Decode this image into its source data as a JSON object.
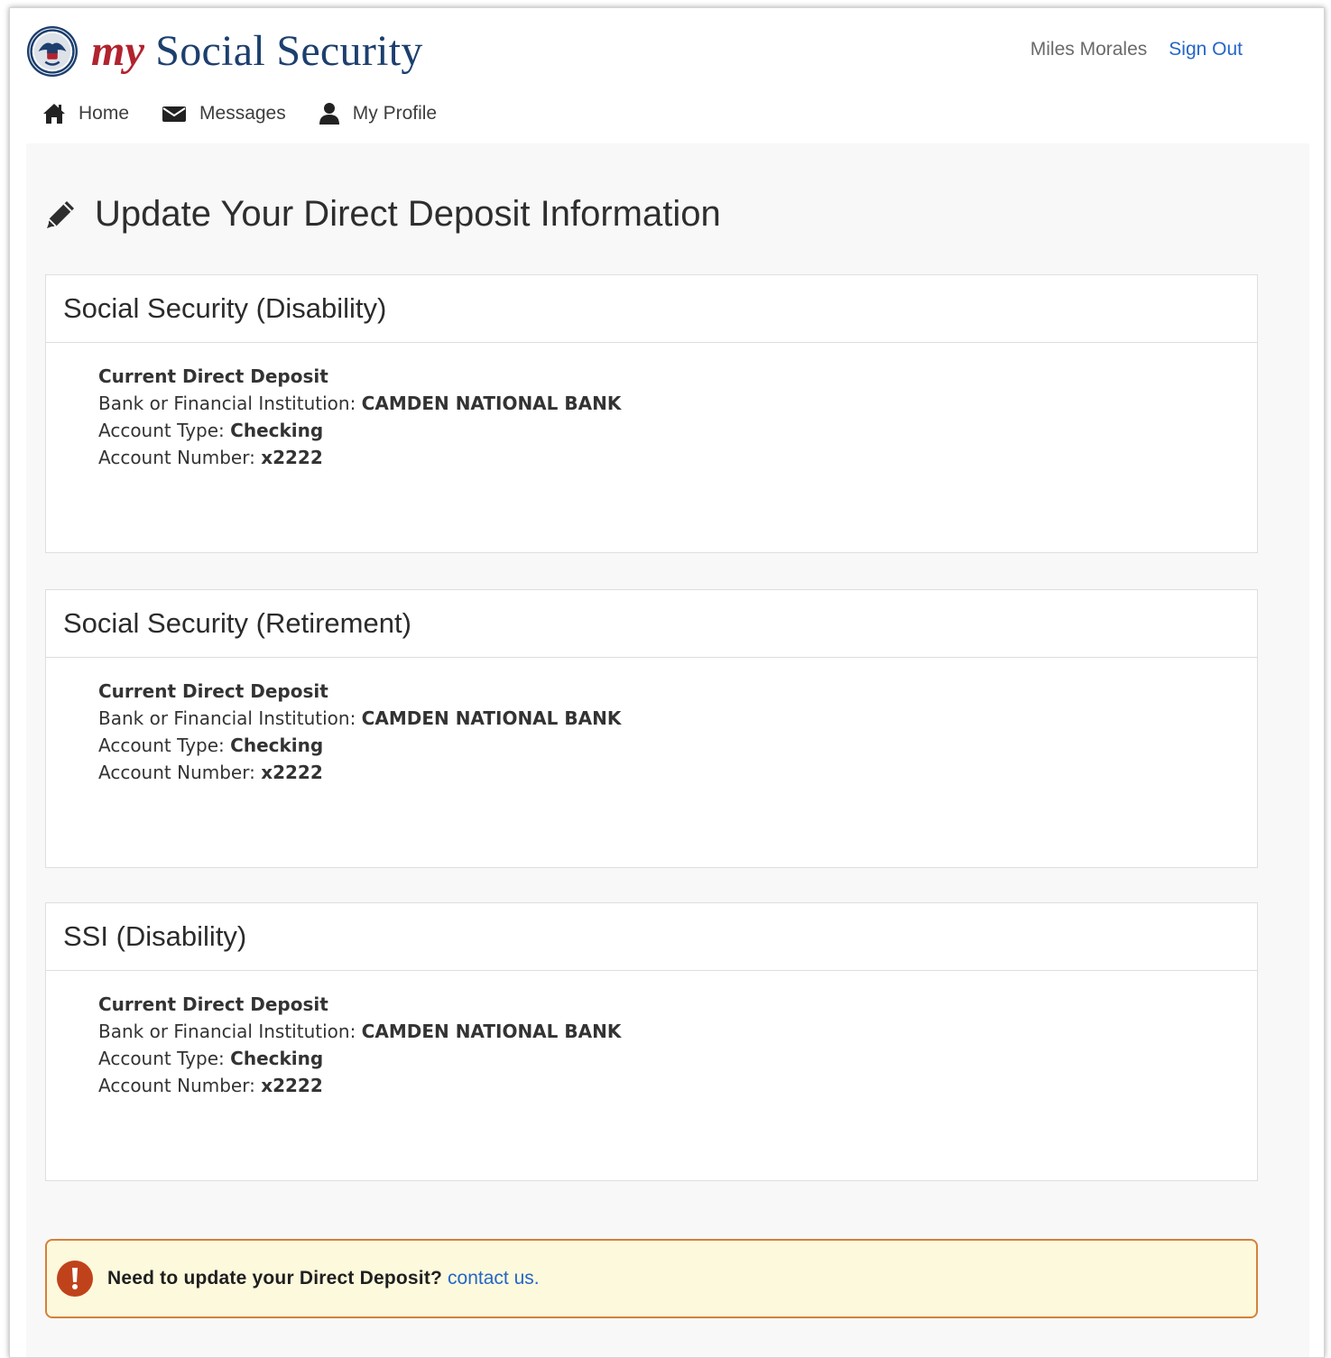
{
  "header": {
    "brand_my": "my",
    "brand_rest": "Social Security",
    "user_name": "Miles Morales",
    "sign_out": "Sign Out"
  },
  "nav": {
    "items": [
      {
        "label": "Home",
        "icon": "home-icon"
      },
      {
        "label": "Messages",
        "icon": "envelope-icon"
      },
      {
        "label": "My Profile",
        "icon": "user-icon"
      }
    ]
  },
  "page": {
    "title": "Update Your Direct Deposit Information",
    "icon": "pencil-icon"
  },
  "panels": [
    {
      "title": "Social Security (Disability)",
      "section_title": "Current Direct Deposit",
      "bank_label": "Bank or Financial Institution:",
      "bank_value": "CAMDEN NATIONAL BANK",
      "type_label": "Account Type:",
      "type_value": "Checking",
      "number_label": "Account Number:",
      "number_value": "x2222"
    },
    {
      "title": "Social Security (Retirement)",
      "section_title": "Current Direct Deposit",
      "bank_label": "Bank or Financial Institution:",
      "bank_value": "CAMDEN NATIONAL BANK",
      "type_label": "Account Type:",
      "type_value": "Checking",
      "number_label": "Account Number:",
      "number_value": "x2222"
    },
    {
      "title": "SSI (Disability)",
      "section_title": "Current Direct Deposit",
      "bank_label": "Bank or Financial Institution:",
      "bank_value": "CAMDEN NATIONAL BANK",
      "type_label": "Account Type:",
      "type_value": "Checking",
      "number_label": "Account Number:",
      "number_value": "x2222"
    }
  ],
  "alert": {
    "icon": "exclamation-icon",
    "text": "Need to update your Direct Deposit?",
    "link": "contact us."
  },
  "colors": {
    "brand_red": "#b1232f",
    "brand_navy": "#1c3f6e",
    "link_blue": "#2466c8",
    "alert_bg": "#fdf9dc",
    "alert_border": "#d4813a",
    "alert_icon": "#c0421b"
  }
}
